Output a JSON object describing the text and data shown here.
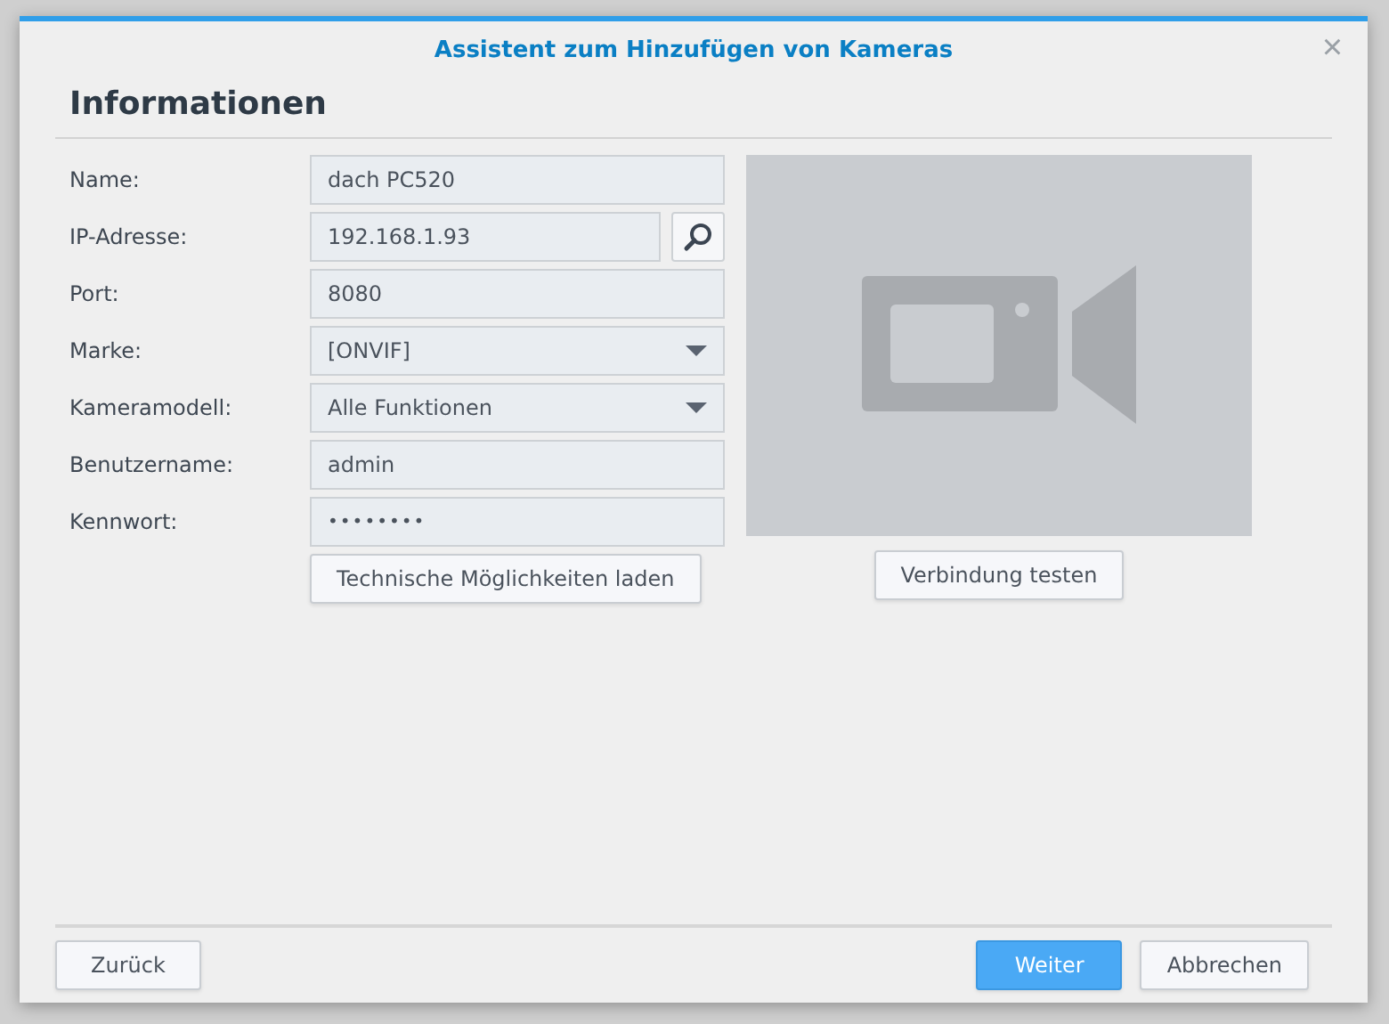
{
  "window": {
    "title": "Assistent zum Hinzufügen von Kameras",
    "close": "×"
  },
  "heading": "Informationen",
  "fields": [
    {
      "label": "Name:",
      "kind": "text",
      "value": "dach PC520"
    },
    {
      "label": "IP-Adresse:",
      "kind": "search",
      "value": "192.168.1.93"
    },
    {
      "label": "Port:",
      "kind": "text",
      "value": "8080"
    },
    {
      "label": "Marke:",
      "kind": "select",
      "value": "[ONVIF]"
    },
    {
      "label": "Kameramodell:",
      "kind": "select",
      "value": "Alle Funktionen"
    },
    {
      "label": "Benutzername:",
      "kind": "text",
      "value": "admin"
    },
    {
      "label": "Kennwort:",
      "kind": "password",
      "value": "••••••••"
    }
  ],
  "load_button": "Technische Möglichkeiten laden",
  "test_button": "Verbindung testen",
  "footer": {
    "back": "Zurück",
    "buttons": [
      {
        "label": "Weiter",
        "kind": "primary"
      },
      {
        "label": "Abbrechen",
        "kind": "normal"
      }
    ]
  }
}
